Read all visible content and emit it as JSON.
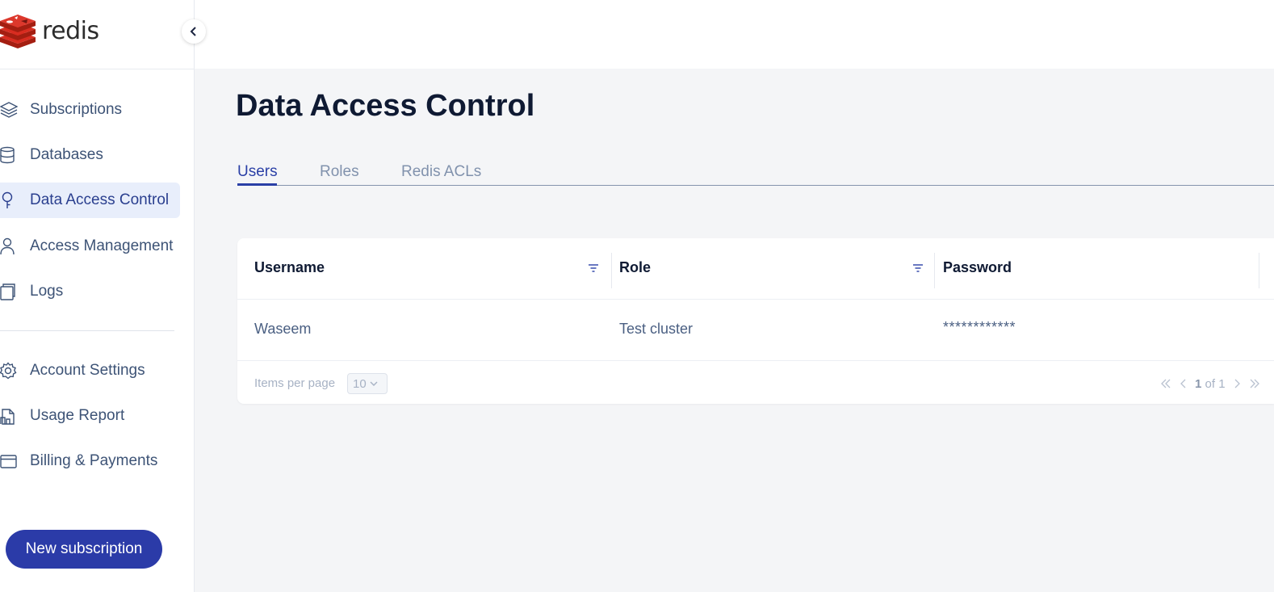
{
  "brand": {
    "name": "redis",
    "logo_color": "#d82c20"
  },
  "sidebar": {
    "collapse_icon": "chevron-left-icon",
    "items": [
      {
        "label": "Subscriptions",
        "icon": "layers-icon",
        "active": false
      },
      {
        "label": "Databases",
        "icon": "database-icon",
        "active": false
      },
      {
        "label": "Data Access Control",
        "icon": "key-icon",
        "active": true
      },
      {
        "label": "Access Management",
        "icon": "user-icon",
        "active": false
      },
      {
        "label": "Logs",
        "icon": "logs-icon",
        "active": false
      }
    ],
    "secondary_items": [
      {
        "label": "Account Settings",
        "icon": "gear-icon"
      },
      {
        "label": "Usage Report",
        "icon": "report-icon"
      },
      {
        "label": "Billing & Payments",
        "icon": "card-icon"
      }
    ],
    "new_subscription_label": "New subscription"
  },
  "main": {
    "title": "Data Access Control",
    "tabs": [
      {
        "label": "Users",
        "active": true
      },
      {
        "label": "Roles",
        "active": false
      },
      {
        "label": "Redis ACLs",
        "active": false
      }
    ],
    "table": {
      "columns": [
        {
          "label": "Username",
          "filterable": true
        },
        {
          "label": "Role",
          "filterable": true
        },
        {
          "label": "Password",
          "filterable": false
        }
      ],
      "rows": [
        {
          "username": "Waseem",
          "role": "Test cluster",
          "password": "************"
        }
      ],
      "footer": {
        "items_per_page_label": "Items per page",
        "items_per_page_value": "10",
        "current_page": "1",
        "of_label": "of 1"
      }
    }
  },
  "colors": {
    "accent": "#2b3ba8",
    "active_nav_bg": "#e8eefb",
    "text_muted": "#3d5376"
  }
}
